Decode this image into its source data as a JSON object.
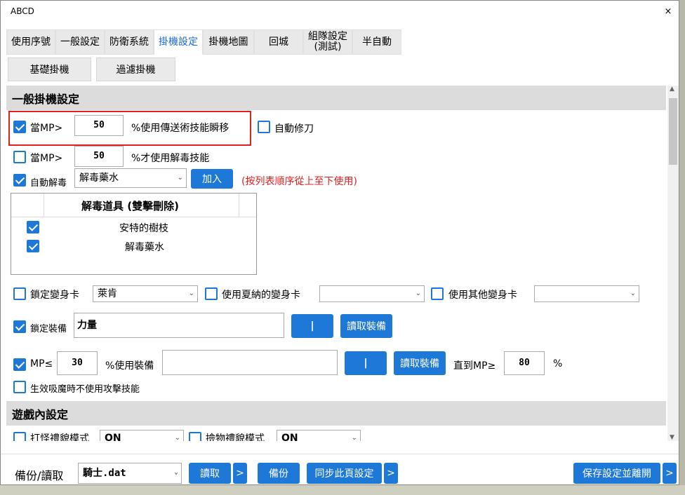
{
  "window": {
    "title": "ABCD",
    "close_glyph": "×"
  },
  "tabs": [
    {
      "label": "使用序號"
    },
    {
      "label": "一般設定"
    },
    {
      "label": "防衛系統"
    },
    {
      "label": "掛機設定"
    },
    {
      "label": "掛機地圖"
    },
    {
      "label": "回城"
    },
    {
      "label": "組隊設定\n(測試)"
    },
    {
      "label": "半自動"
    }
  ],
  "active_tab": "掛機設定",
  "subtabs": [
    {
      "label": "基礎掛機"
    },
    {
      "label": "過濾掛機"
    }
  ],
  "sections": {
    "general": "一般掛機設定",
    "ingame": "遊戲內設定"
  },
  "general": {
    "mp_teleport": {
      "checked": true,
      "prefix": "當MP>",
      "value": "50",
      "suffix": "%使用傳送術技能瞬移"
    },
    "auto_repair": {
      "checked": false,
      "label": "自動修刀"
    },
    "mp_detox": {
      "checked": false,
      "prefix": "當MP>",
      "value": "50",
      "suffix": "%才使用解毒技能"
    },
    "auto_detox": {
      "checked": true,
      "label": "自動解毒",
      "select": "解毒藥水",
      "add_button": "加入",
      "note": "(按列表順序從上至下使用)"
    },
    "detox_list": {
      "header": "解毒道具 (雙擊刪除)",
      "items": [
        {
          "checked": true,
          "label": "安特的樹枝"
        },
        {
          "checked": true,
          "label": "解毒藥水"
        }
      ]
    },
    "lock_poly": {
      "checked": false,
      "label": "鎖定變身卡",
      "select": "萊肯"
    },
    "shaena_poly": {
      "checked": false,
      "label": "使用夏納的變身卡",
      "select": ""
    },
    "other_poly": {
      "checked": false,
      "label": "使用其他變身卡",
      "select": ""
    },
    "lock_equip": {
      "checked": true,
      "label": "鎖定裝備",
      "value": "力量",
      "sep_button": "|",
      "read_button": "讀取裝備"
    },
    "mp_equip": {
      "checked": true,
      "prefix": "MP≤",
      "value": "30",
      "suffix": "%使用裝備",
      "equip": "",
      "sep_button": "|",
      "read_button": "讀取裝備",
      "until_label": "直到MP≥",
      "until_value": "80",
      "until_unit": "%"
    },
    "no_attack_drain": {
      "checked": false,
      "label": "生效吸魔時不使用攻擊技能"
    }
  },
  "ingame": {
    "monster_etiquette": {
      "checked": false,
      "label": "打怪禮貌模式",
      "select": "ON"
    },
    "loot_etiquette": {
      "checked": false,
      "label": "撿物禮貌模式",
      "select": "ON"
    }
  },
  "footer": {
    "backup_label": "備份/讀取",
    "file_select": "騎士.dat",
    "read_button": "讀取",
    "more1": ">",
    "backup_button": "備份",
    "sync_button": "同步此頁設定",
    "more2": ">",
    "save_exit_button": "保存設定並離開",
    "more3": ">"
  },
  "colors": {
    "accent": "#1e78d7",
    "highlight_border": "#e02020",
    "note": "#e02020",
    "active_tab_text": "#1e6ad8",
    "section_bg": "#dcdcdc"
  }
}
